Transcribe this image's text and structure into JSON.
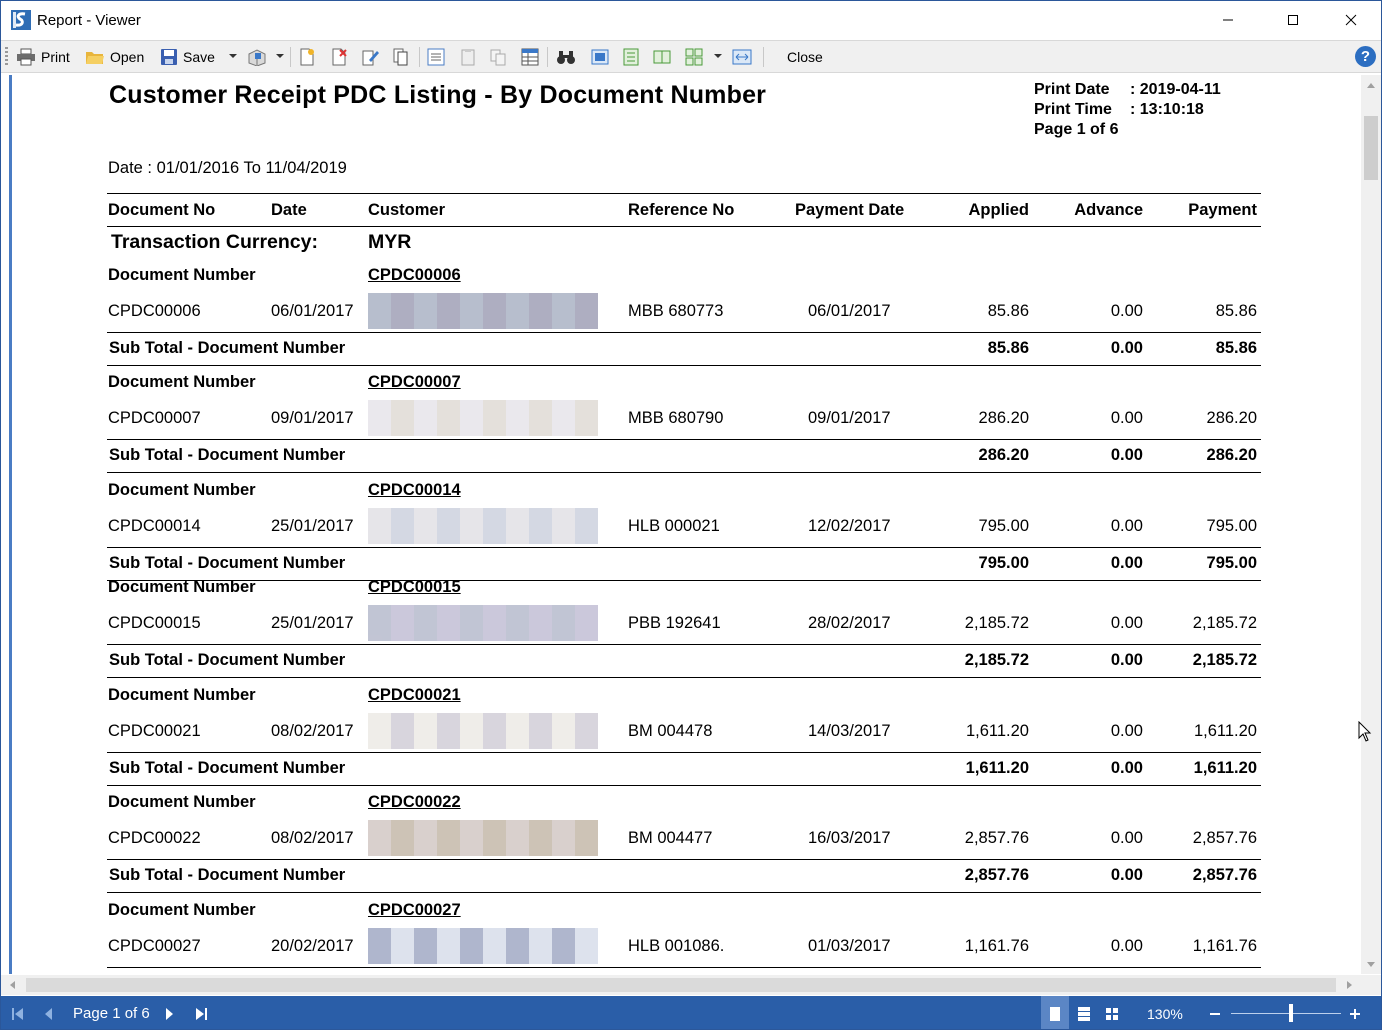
{
  "window": {
    "title": "Report - Viewer"
  },
  "toolbar": {
    "print_label": "Print",
    "open_label": "Open",
    "save_label": "Save",
    "close_label": "Close"
  },
  "report": {
    "title": "Customer Receipt PDC Listing - By Document Number",
    "print_date_label": "Print Date",
    "print_date": ": 2019-04-11",
    "print_time_label": "Print Time",
    "print_time": ": 13:10:18",
    "page_label": "Page 1 of 6",
    "date_range": "Date : 01/01/2016 To 11/04/2019",
    "columns": [
      "Document No",
      "Date",
      "Customer",
      "Reference No",
      "Payment Date",
      "Applied",
      "Advance",
      "Payment"
    ],
    "currency_label": "Transaction Currency:",
    "currency": "MYR",
    "group_label": "Document Number",
    "subtotal_label": "Sub Total - Document Number",
    "groups": [
      {
        "doc": "CPDC00006",
        "date": "06/01/2017",
        "ref": "MBB 680773",
        "pay_date": "06/01/2017",
        "applied": "85.86",
        "advance": "0.00",
        "payment": "85.86",
        "sub_applied": "85.86",
        "sub_advance": "0.00",
        "sub_payment": "85.86"
      },
      {
        "doc": "CPDC00007",
        "date": "09/01/2017",
        "ref": "MBB 680790",
        "pay_date": "09/01/2017",
        "applied": "286.20",
        "advance": "0.00",
        "payment": "286.20",
        "sub_applied": "286.20",
        "sub_advance": "0.00",
        "sub_payment": "286.20"
      },
      {
        "doc": "CPDC00014",
        "date": "25/01/2017",
        "ref": "HLB 000021",
        "pay_date": "12/02/2017",
        "applied": "795.00",
        "advance": "0.00",
        "payment": "795.00",
        "sub_applied": "795.00",
        "sub_advance": "0.00",
        "sub_payment": "795.00"
      },
      {
        "doc": "CPDC00015",
        "date": "25/01/2017",
        "ref": "PBB 192641",
        "pay_date": "28/02/2017",
        "applied": "2,185.72",
        "advance": "0.00",
        "payment": "2,185.72",
        "sub_applied": "2,185.72",
        "sub_advance": "0.00",
        "sub_payment": "2,185.72"
      },
      {
        "doc": "CPDC00021",
        "date": "08/02/2017",
        "ref": "BM 004478",
        "pay_date": "14/03/2017",
        "applied": "1,611.20",
        "advance": "0.00",
        "payment": "1,611.20",
        "sub_applied": "1,611.20",
        "sub_advance": "0.00",
        "sub_payment": "1,611.20"
      },
      {
        "doc": "CPDC00022",
        "date": "08/02/2017",
        "ref": "BM 004477",
        "pay_date": "16/03/2017",
        "applied": "2,857.76",
        "advance": "0.00",
        "payment": "2,857.76",
        "sub_applied": "2,857.76",
        "sub_advance": "0.00",
        "sub_payment": "2,857.76"
      },
      {
        "doc": "CPDC00027",
        "date": "20/02/2017",
        "ref": "HLB 001086.",
        "pay_date": "01/03/2017",
        "applied": "1,161.76",
        "advance": "0.00",
        "payment": "1,161.76"
      }
    ]
  },
  "statusbar": {
    "page_indicator": "Page 1 of 6",
    "zoom": "130%"
  },
  "colors": {
    "accent": "#2a5ea8",
    "help": "#2c6ec1"
  }
}
